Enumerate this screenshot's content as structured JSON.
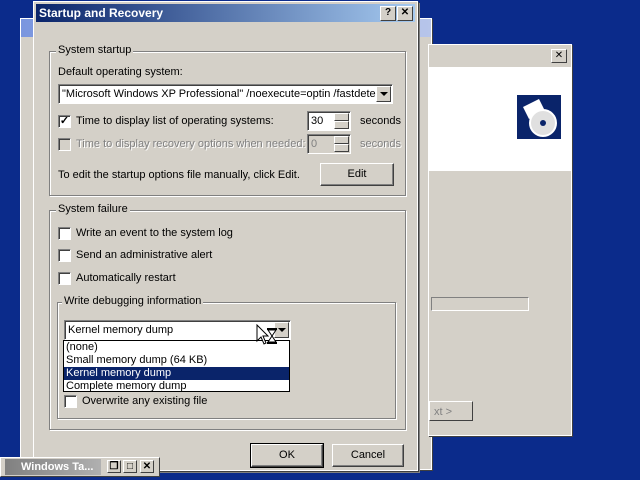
{
  "dialog": {
    "title": "Startup and Recovery",
    "help_button": "?",
    "close_button": "✕"
  },
  "system_startup": {
    "group_label": "System startup",
    "default_os_label": "Default operating system:",
    "default_os_value": "\"Microsoft Windows XP Professional\" /noexecute=optin /fastdetect",
    "time_display_os_label": "Time to display list of operating systems:",
    "time_display_os_checked": true,
    "time_display_os_value": "30",
    "time_display_os_unit": "seconds",
    "time_recovery_label": "Time to display recovery options when needed:",
    "time_recovery_checked": false,
    "time_recovery_value": "0",
    "time_recovery_unit": "seconds",
    "edit_hint": "To edit the startup options file manually, click Edit.",
    "edit_button": "Edit"
  },
  "system_failure": {
    "group_label": "System failure",
    "write_event": "Write an event to the system log",
    "send_alert": "Send an administrative alert",
    "auto_restart": "Automatically restart",
    "debug_group_label": "Write debugging information",
    "debug_selected": "Kernel memory dump",
    "debug_options": [
      "(none)",
      "Small memory dump (64 KB)",
      "Kernel memory dump",
      "Complete memory dump"
    ],
    "overwrite_label": "Overwrite any existing file"
  },
  "footer": {
    "ok_button": "OK",
    "cancel_button": "Cancel"
  },
  "background_window": {
    "next_button_fragment": "xt >"
  },
  "taskbar": {
    "title": "Windows Ta..."
  },
  "colors": {
    "title_active": "#0a246a",
    "face": "#d4d0c8",
    "selection": "#0a246a",
    "desktop": "#0b2b8b"
  }
}
